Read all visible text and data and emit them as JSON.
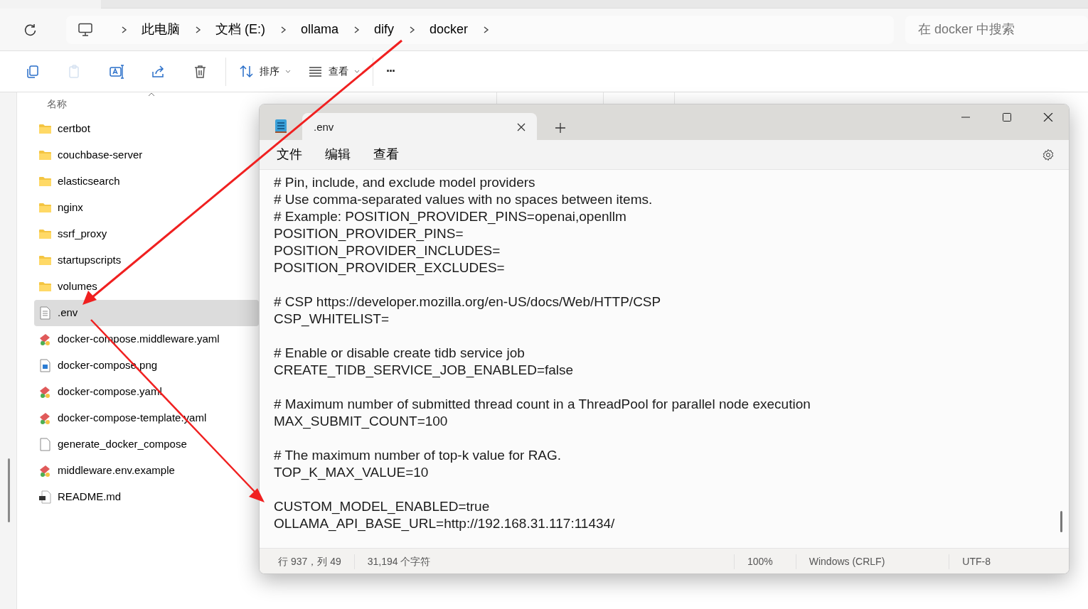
{
  "explorer": {
    "breadcrumb": [
      "此电脑",
      "文档 (E:)",
      "ollama",
      "dify",
      "docker"
    ],
    "search": {
      "placeholder": "在 docker 中搜索"
    },
    "commands": [
      {
        "kind": "copy"
      },
      {
        "kind": "paste",
        "disabled": true
      },
      {
        "kind": "rename"
      },
      {
        "kind": "share"
      },
      {
        "kind": "delete"
      },
      {
        "kind": "sort",
        "label": "排序"
      },
      {
        "kind": "view",
        "label": "查看"
      },
      {
        "kind": "more",
        "label": "···"
      }
    ],
    "name_column": "名称",
    "files": [
      {
        "name": "certbot",
        "kind": "folder",
        "selected": false
      },
      {
        "name": "couchbase-server",
        "kind": "folder",
        "selected": false
      },
      {
        "name": "elasticsearch",
        "kind": "folder",
        "selected": false
      },
      {
        "name": "nginx",
        "kind": "folder",
        "selected": false
      },
      {
        "name": "ssrf_proxy",
        "kind": "folder",
        "selected": false
      },
      {
        "name": "startupscripts",
        "kind": "folder",
        "selected": false
      },
      {
        "name": "volumes",
        "kind": "folder",
        "selected": false
      },
      {
        "name": ".env",
        "kind": "text",
        "selected": true
      },
      {
        "name": "docker-compose.middleware.yaml",
        "kind": "yaml",
        "selected": false
      },
      {
        "name": "docker-compose.png",
        "kind": "image",
        "selected": false
      },
      {
        "name": "docker-compose.yaml",
        "kind": "yaml",
        "selected": false
      },
      {
        "name": "docker-compose-template.yaml",
        "kind": "yaml",
        "selected": false
      },
      {
        "name": "generate_docker_compose",
        "kind": "blank",
        "selected": false
      },
      {
        "name": "middleware.env.example",
        "kind": "yaml",
        "selected": false
      },
      {
        "name": "README.md",
        "kind": "markdown",
        "selected": false
      }
    ]
  },
  "notepad": {
    "tab": ".env",
    "menu": [
      "文件",
      "编辑",
      "查看"
    ],
    "blocks": [
      [
        "# Pin, include, and exclude model providers",
        "# Use comma-separated values with no spaces between items.",
        "# Example: POSITION_PROVIDER_PINS=openai,openllm",
        "POSITION_PROVIDER_PINS=",
        "POSITION_PROVIDER_INCLUDES=",
        "POSITION_PROVIDER_EXCLUDES="
      ],
      [
        "# CSP https://developer.mozilla.org/en-US/docs/Web/HTTP/CSP",
        "CSP_WHITELIST="
      ],
      [
        "# Enable or disable create tidb service job",
        "CREATE_TIDB_SERVICE_JOB_ENABLED=false"
      ],
      [
        "# Maximum number of submitted thread count in a ThreadPool for parallel node execution",
        "MAX_SUBMIT_COUNT=100"
      ],
      [
        "# The maximum number of top-k value for RAG.",
        "TOP_K_MAX_VALUE=10"
      ],
      [
        "CUSTOM_MODEL_ENABLED=true",
        "OLLAMA_API_BASE_URL=http://192.168.31.117:11434/"
      ]
    ],
    "status": {
      "position": "行 937，列 49",
      "chars": "31,194 个字符",
      "zoom": "100%",
      "line_ending": "Windows (CRLF)",
      "encoding": "UTF-8"
    }
  }
}
